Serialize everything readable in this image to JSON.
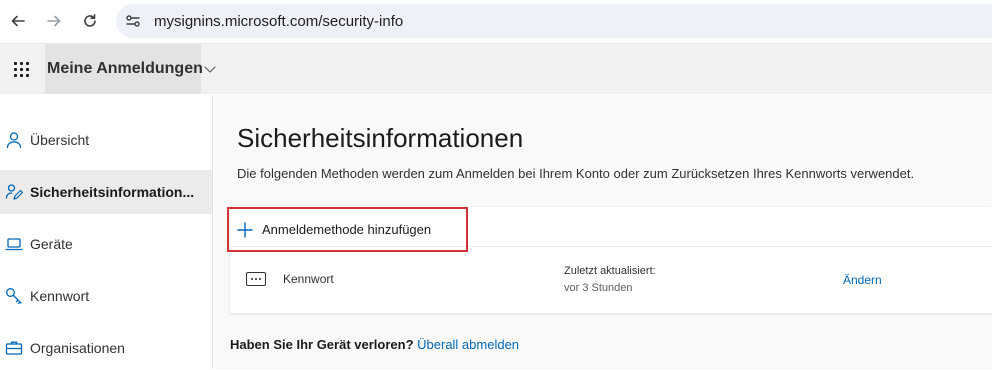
{
  "browser": {
    "url": "mysignins.microsoft.com/security-info"
  },
  "header": {
    "app_title": "Meine Anmeldungen"
  },
  "sidebar": {
    "items": [
      {
        "label": "Übersicht",
        "icon": "person-icon",
        "active": false
      },
      {
        "label": "Sicherheitsinformation...",
        "icon": "security-info-icon",
        "active": true
      },
      {
        "label": "Geräte",
        "icon": "laptop-icon",
        "active": false
      },
      {
        "label": "Kennwort",
        "icon": "key-icon",
        "active": false
      },
      {
        "label": "Organisationen",
        "icon": "briefcase-icon",
        "active": false
      }
    ]
  },
  "main": {
    "title": "Sicherheitsinformationen",
    "description": "Die folgenden Methoden werden zum Anmelden bei Ihrem Konto oder zum Zurücksetzen Ihres Kennworts verwendet.",
    "add_method_label": "Anmeldemethode hinzufügen",
    "methods": [
      {
        "name": "Kennwort",
        "icon": "password-dots-icon",
        "updated_label": "Zuletzt aktualisiert:",
        "updated_value": "vor 3 Stunden",
        "action": "Ändern"
      }
    ],
    "lost_device_question": "Haben Sie Ihr Gerät verloren?",
    "lost_device_link": "Überall abmelden"
  },
  "colors": {
    "accent_link": "#0067b8",
    "highlight_border": "#d13438",
    "active_nav_bg": "#edebe9"
  }
}
